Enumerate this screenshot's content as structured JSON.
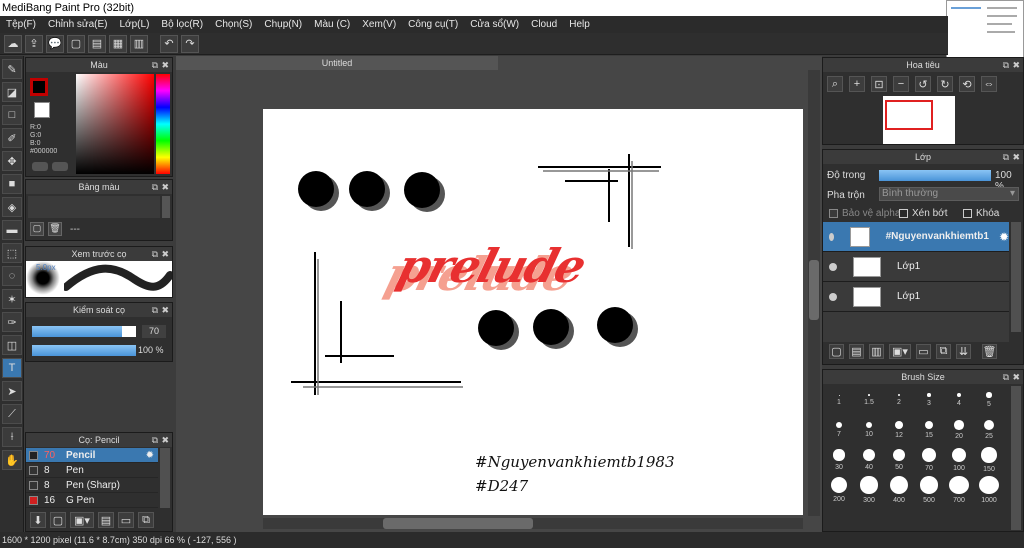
{
  "window": {
    "title": "MediBang Paint Pro (32bit)"
  },
  "menu": [
    "Tệp(F)",
    "Chỉnh sửa(E)",
    "Lớp(L)",
    "Bộ lọc(R)",
    "Chọn(S)",
    "Chụp(N)",
    "Màu (C)",
    "Xem(V)",
    "Công cụ(T)",
    "Cửa sổ(W)",
    "Cloud",
    "Help"
  ],
  "color_panel": {
    "title": "Màu",
    "r": "R:0",
    "g": "G:0",
    "b": "B:0",
    "hex": "#000000",
    "fg": "#c00000"
  },
  "palette_panel": {
    "title": "Bảng màu",
    "dash": "---"
  },
  "brush_preview": {
    "title": "Xem trước cọ",
    "size": "5.0px"
  },
  "brush_control": {
    "title": "Kiểm soát cọ",
    "size_value": "70",
    "opacity_value": "100 %",
    "size_fill": 0.87,
    "opacity_fill": 1.0
  },
  "pen_panel": {
    "title": "Cọ: Pencil",
    "items": [
      {
        "size": "70",
        "name": "Pencil",
        "color": "#222222"
      },
      {
        "size": "8",
        "name": "Pen",
        "color": "#333333"
      },
      {
        "size": "8",
        "name": "Pen (Sharp)",
        "color": "#333333"
      },
      {
        "size": "16",
        "name": "G Pen",
        "color": "#d02020"
      }
    ]
  },
  "document": {
    "tab": "Untitled"
  },
  "canvas_text": {
    "line1": "#Nguyenvankhiemtb1983",
    "line2": "#D247",
    "word": "prelude"
  },
  "navigator": {
    "title": "Hoa tiêu"
  },
  "layer_panel": {
    "title": "Lớp",
    "opacity_label": "Độ trong",
    "opacity_value": "100 %",
    "opacity_fill": 1.0,
    "blend_label": "Pha trộn",
    "blend_value": "Bình thường",
    "protect_alpha": "Bảo vệ alpha",
    "clip": "Xén bớt",
    "lock": "Khóa",
    "layers": [
      {
        "name": "#Nguyenvankhiemtb1"
      },
      {
        "name": "Lớp1"
      },
      {
        "name": "Lớp1"
      }
    ]
  },
  "brush_size_panel": {
    "title": "Brush Size",
    "sizes": [
      "1",
      "1.5",
      "2",
      "3",
      "4",
      "5",
      "7",
      "10",
      "12",
      "15",
      "20",
      "25",
      "30",
      "40",
      "50",
      "70",
      "100",
      "150",
      "200",
      "300",
      "400",
      "500",
      "700",
      "1000"
    ]
  },
  "status": {
    "text": "1600 * 1200 pixel  (11.6 * 8.7cm)  350 dpi  66 %  ( -127, 556 )"
  }
}
